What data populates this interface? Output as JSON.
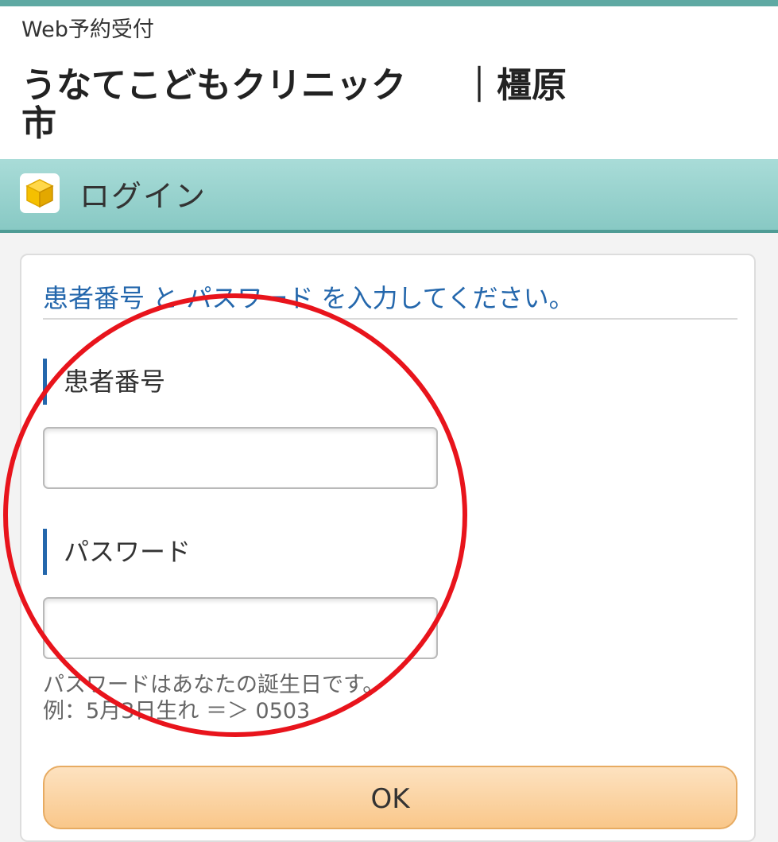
{
  "header": {
    "subtitle": "Web予約受付",
    "clinic_name": "うなてこどもクリニック",
    "location": "｜橿原市"
  },
  "section": {
    "icon": "yellow-cube-icon",
    "title": "ログイン"
  },
  "login_form": {
    "instruction": "患者番号 と パスワード を入力してください。",
    "patient_number_label": "患者番号",
    "patient_number_value": "",
    "password_label": "パスワード",
    "password_value": "",
    "hint_line_1": "パスワードはあなたの誕生日です。",
    "hint_line_2": "例：5月3日生れ ＝＞ 0503",
    "ok_label": "OK"
  },
  "colors": {
    "accent_teal": "#5fa9a3",
    "label_blue": "#2467ac",
    "button_orange": "#f9c78a",
    "annotation_red": "#e8141c"
  }
}
